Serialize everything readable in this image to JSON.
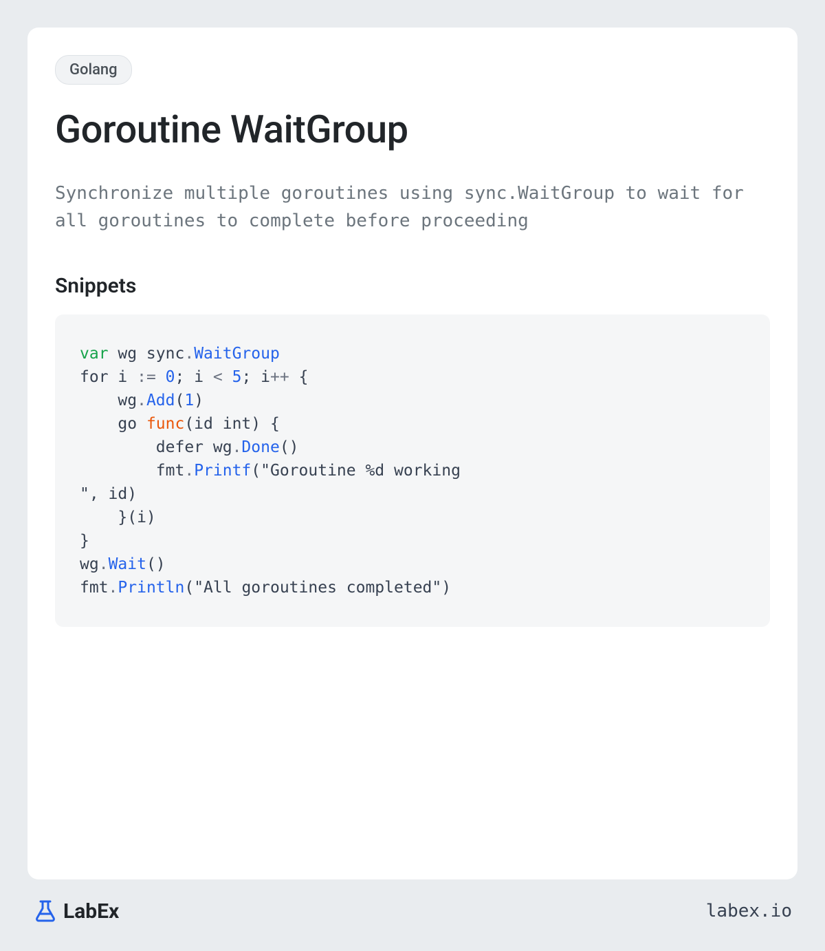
{
  "tag": "Golang",
  "title": "Goroutine WaitGroup",
  "description": "Synchronize multiple goroutines using sync.WaitGroup to wait for all goroutines to complete before proceeding",
  "section_title": "Snippets",
  "code": {
    "line1_var": "var",
    "line1_wg": " wg sync",
    "line1_dot": ".",
    "line1_type": "WaitGroup",
    "line2_for": "for",
    "line2_a": " i ",
    "line2_assign": ":=",
    "line2_sp": " ",
    "line2_zero": "0",
    "line2_b": "; i ",
    "line2_lt": "<",
    "line2_sp2": " ",
    "line2_five": "5",
    "line2_c": "; i",
    "line2_inc": "++",
    "line2_brace": " {",
    "line3_indent": "    wg",
    "line3_dot": ".",
    "line3_add": "Add",
    "line3_p1": "(",
    "line3_one": "1",
    "line3_p2": ")",
    "line4_indent": "    go ",
    "line4_func": "func",
    "line4_params": "(id int) {",
    "line5_indent": "        defer wg",
    "line5_dot": ".",
    "line5_done": "Done",
    "line5_parens": "()",
    "line6_indent": "        fmt",
    "line6_dot": ".",
    "line6_printf": "Printf",
    "line6_p1": "(",
    "line6_str": "\"Goroutine %d working\n\"",
    "line6_rest": ", id)",
    "line7": "    }(i)",
    "line8": "}",
    "line9_a": "wg",
    "line9_dot": ".",
    "line9_wait": "Wait",
    "line9_parens": "()",
    "line10_a": "fmt",
    "line10_dot": ".",
    "line10_println": "Println",
    "line10_p1": "(",
    "line10_str": "\"All goroutines completed\"",
    "line10_p2": ")"
  },
  "footer": {
    "logo_text": "LabEx",
    "site_url": "labex.io"
  }
}
